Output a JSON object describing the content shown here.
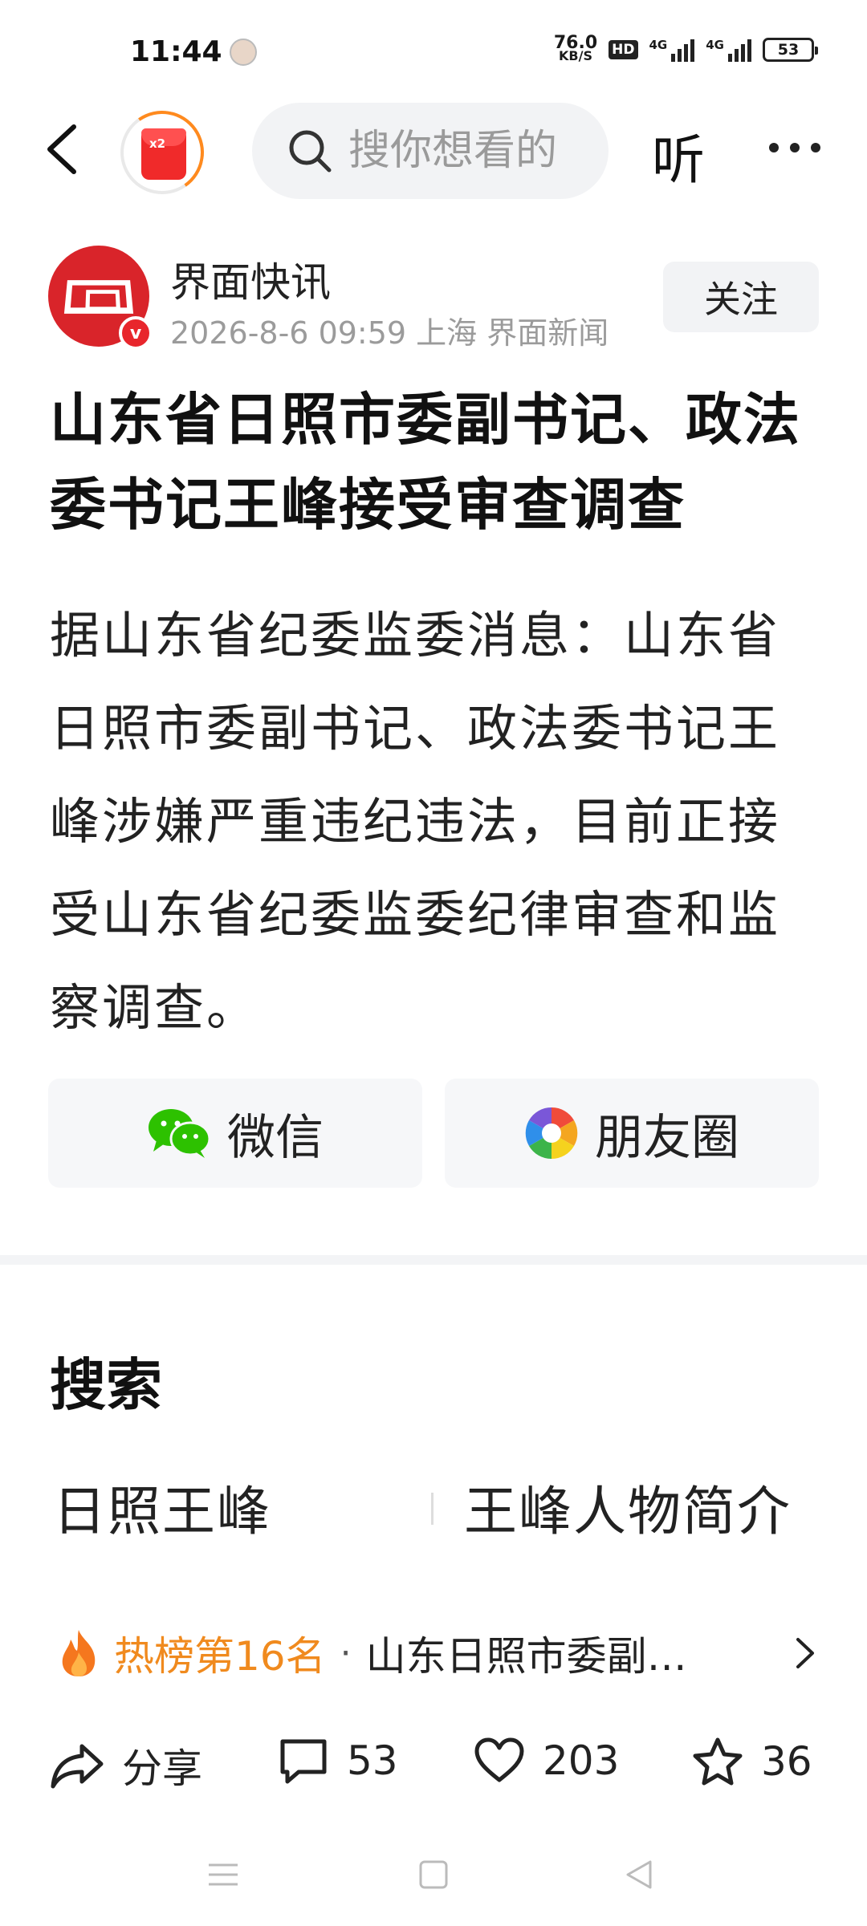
{
  "status_bar": {
    "time": "11:44",
    "net_speed_value": "76.0",
    "net_speed_unit": "KB/S",
    "hd": "HD",
    "signal1": "4G",
    "signal2": "4G",
    "battery": "53"
  },
  "top_nav": {
    "reward_multiplier": "x2",
    "search_placeholder": "搜你想看的",
    "listen_label": "听"
  },
  "author": {
    "name": "界面快讯",
    "verified_mark": "v",
    "meta": "2026-8-6  09:59  上海  界面新闻",
    "follow_label": "关注"
  },
  "article": {
    "title": "山东省日照市委副书记、政法委书记王峰接受审查调查",
    "body": "据山东省纪委监委消息：山东省日照市委副书记、政法委书记王峰涉嫌严重违纪违法，目前正接受山东省纪委监委纪律审查和监察调查。"
  },
  "share": {
    "wechat_label": "微信",
    "moments_label": "朋友圈"
  },
  "search_section": {
    "title": "搜索",
    "suggestions": [
      "日照王峰",
      "王峰人物简介"
    ]
  },
  "hot": {
    "rank_label": "热榜第16名",
    "separator": "·",
    "headline": "山东日照市委副书记、政法委书记王峰接受审查调查"
  },
  "actions": {
    "share_label": "分享",
    "comments": "53",
    "likes": "203",
    "favorites": "36"
  },
  "colors": {
    "accent_orange": "#f08a1e",
    "brand_red": "#d9242a",
    "wechat_green": "#2dc100"
  }
}
